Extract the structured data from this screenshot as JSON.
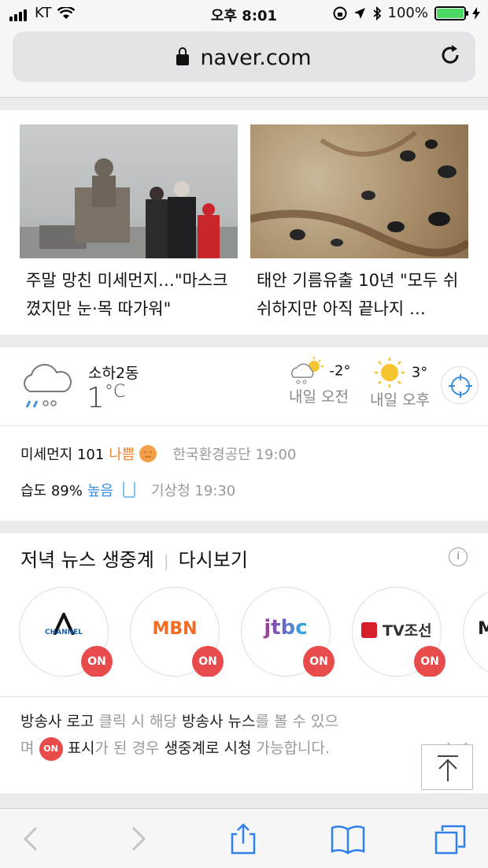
{
  "status_bar": {
    "carrier": "KT",
    "time": "오후 8:01",
    "battery": "100%"
  },
  "browser": {
    "url": "naver.com"
  },
  "news": [
    {
      "title": "주말 망친 미세먼지…\"마스크 꼈지만 눈·목 따가워\""
    },
    {
      "title": "태안 기름유출 10년 \"모두 쉬쉬하지만 아직 끝나지 …"
    }
  ],
  "weather": {
    "location": "소하2동",
    "current_temp": "1",
    "unit": "°C",
    "forecast": [
      {
        "temp": "-2°",
        "label": "내일 오전"
      },
      {
        "temp": "3°",
        "label": "내일 오후"
      }
    ],
    "dust_label": "미세먼지 101",
    "dust_status": "나쁨",
    "dust_source": "한국환경공단 19:00",
    "humidity_label": "습도 89%",
    "humidity_status": "높음",
    "humidity_source": "기상청 19:30"
  },
  "live_news": {
    "title": "저녁 뉴스 생중계",
    "replay": "다시보기",
    "info_icon": "i",
    "channels": [
      {
        "name": "CHANNEL A",
        "logo": "CHANNEL",
        "on": "ON"
      },
      {
        "name": "MBN",
        "logo": "MBN",
        "on": "ON"
      },
      {
        "name": "JTBC",
        "logo": "jtbc",
        "on": "ON"
      },
      {
        "name": "TV조선",
        "logo": "TV조선",
        "on": "ON"
      }
    ],
    "desc": {
      "part1": "방송사 로고",
      "part2": " 클릭 시 해당 ",
      "part3": "방송사 뉴스",
      "part4": "를 볼 수 있으며 ",
      "on_badge": "ON",
      "part5": " 표시",
      "part6": "가 된 경우 ",
      "part7": "생중계로 시청",
      "part8": " 가능합니다."
    }
  }
}
